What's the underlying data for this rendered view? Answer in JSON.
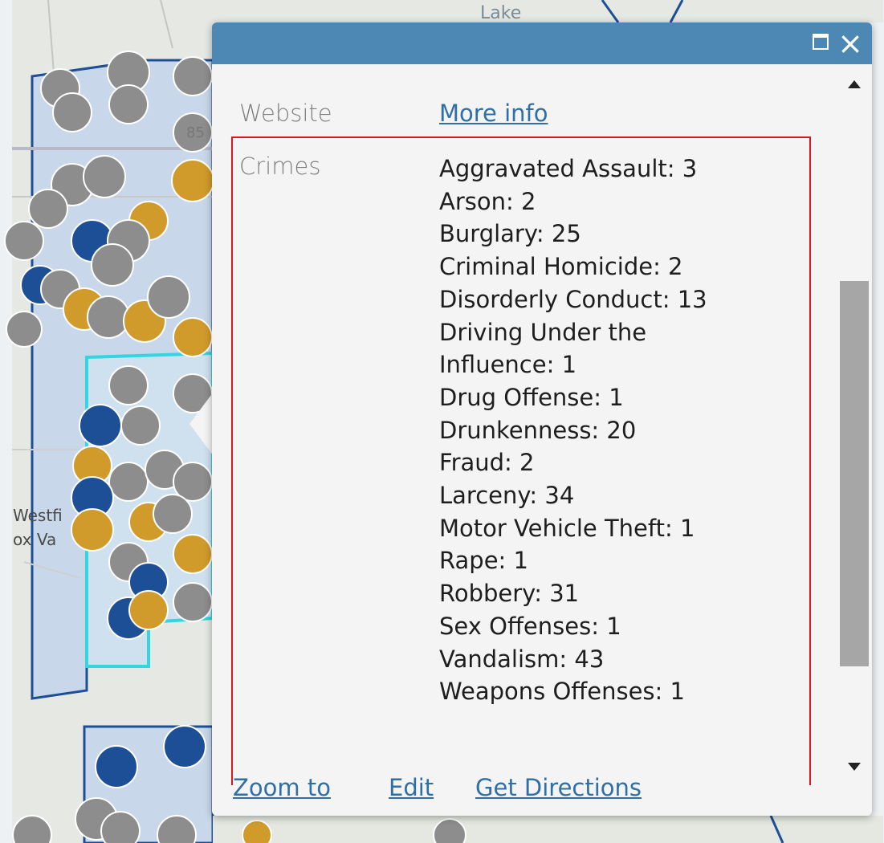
{
  "map": {
    "place_label_1": "Westfi",
    "place_label_2": "ox Va",
    "road_label": "85",
    "lake_label": "Lake"
  },
  "popup": {
    "header_color": "#4d88b5",
    "maximize_icon": "maximize-icon",
    "close_symbol": "×",
    "website": {
      "label": "Website",
      "link_text": "More info"
    },
    "crimes": {
      "label": "Crimes",
      "highlight_color": "#e0141e",
      "items": [
        "Aggravated Assault: 3",
        "Arson: 2",
        "Burglary: 25",
        "Criminal Homicide: 2",
        "Disorderly Conduct: 13",
        "Driving Under the",
        "Influence: 1",
        "Drug Offense: 1",
        "Drunkenness: 20",
        "Fraud: 2",
        "Larceny: 34",
        "Motor Vehicle Theft: 1",
        "Rape: 1",
        "Robbery: 31",
        "Sex Offenses: 1",
        "Vandalism: 43",
        "Weapons Offenses: 1"
      ]
    },
    "footer": {
      "zoom_to": "Zoom to",
      "edit": "Edit",
      "get_directions": "Get Directions"
    }
  }
}
